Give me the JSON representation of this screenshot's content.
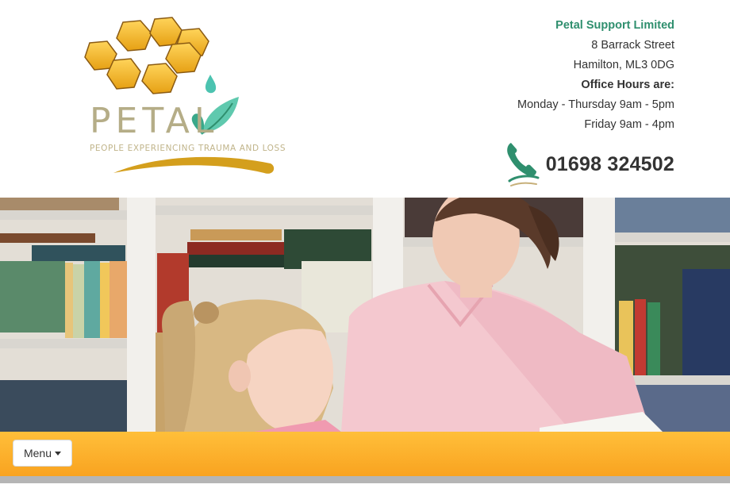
{
  "logo": {
    "word": "PETAL",
    "tagline": "PEOPLE EXPERIENCING TRAUMA AND LOSS"
  },
  "contact": {
    "company": "Petal Support Limited",
    "address_line1": "8 Barrack Street",
    "address_line2": "Hamilton, ML3 0DG",
    "hours_heading": "Office Hours are:",
    "hours_weekday": "Monday - Thursday 9am - 5pm",
    "hours_friday": "Friday 9am - 4pm",
    "phone": "01698 324502",
    "phone_icon": "telephone-icon"
  },
  "colors": {
    "brand_green": "#2f8f6e",
    "honeycomb_gold": "#f2b21e",
    "nav_orange": "#ffb62e"
  },
  "nav": {
    "menu_label": "Menu",
    "menu_icon": "caret-down-icon"
  }
}
